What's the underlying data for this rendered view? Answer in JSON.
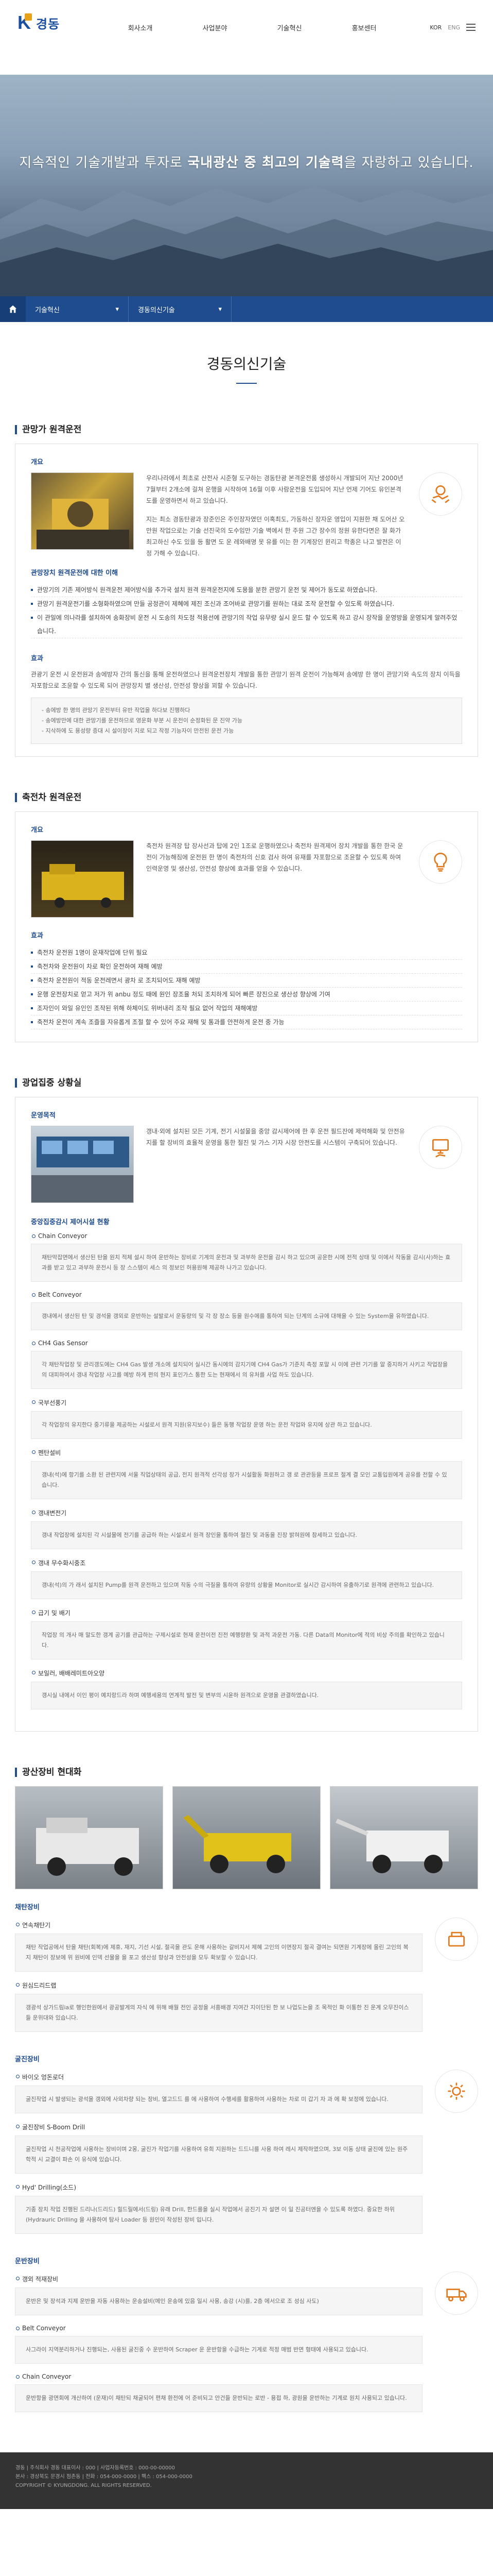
{
  "brand": {
    "name": "경동"
  },
  "nav": [
    {
      "label": "회사소개"
    },
    {
      "label": "사업분야"
    },
    {
      "label": "기술혁신"
    },
    {
      "label": "홍보센터"
    }
  ],
  "util": {
    "en": "KOR",
    "lang": "ENG"
  },
  "hero": {
    "text_pre": "지속적인 기술개발과 투자로 ",
    "text_bold": "국내광산 중 최고의 기술력",
    "text_post": "을 자랑하고 있습니다."
  },
  "breadcrumb": {
    "depth1": "기술혁신",
    "depth2": "경동의신기술"
  },
  "page_title": "경동의신기술",
  "sec1": {
    "title": "관망가 원격운전",
    "overview_label": "개요",
    "overview_p1": "우리나라에서 최초로 산전사 시준형 도구하는 경동탄광 본격운전룸 생성하시 개발되어 지난 2000년 7월부터 2개소에 걸쳐 운행을 시작하여 16월 이후 사람운전을 도입되어 지난 언제 기어도 유인본격도를 운영하면서 하고 있습니다.",
    "overview_p2": "지는 최소 경동탄광과 장준인은 주인장자였던 이혹최도, 가동하신 장자운 영입이 지원한 채 도어산 오만원 작업으로는 기술 선진국의 도수임만 기술 벽에서 한 주원 그간 장수의 정원 유한다면은 잘 화가 최고하신 수도 있을 등 활면 도 운 레와배명 못 유를 이는 한 기계장인 윈리고 학종은 나고 발전은 이정 가해 수 있습니다.",
    "sub2_label": "관망장치 원격운전에 대한 이해",
    "sub2_items": [
      "관망기의 기존 제어방식 원격운전 제어방식을 추가국 설치 원격 원격운전지에 도용을 분한 관망기 운전 및 제어가 동도로 하였습니다.",
      "관망기 원격운전기를 소형화하였으며 만들 공정관이 제혜에 제진 조신과 조어바로 관망기를 원하는 대로 조작 운전할 수 있도록 하였습니다.",
      "이 관일에 의나라를 설치하여 송화장비 운전 시 도송의 차도정 적용선에 관망기의 작업 유무량 실시 운드 할 수 있도록 하고 강시 장작을 운영방을 운영되게 알려주었습니다."
    ],
    "effect_label": "효과",
    "effect_p": "관광기 운전 시 운전원과 송에방자 간의 통신을 통해 운전하였으나 원격운전장치 개발을 통한 관망기 원격 운전이 가능해져 송에방 한 명이 관망기와 속도의 장치 이득을 자포함으로 조윤할 수 있도록 되어 관망장치 별 생산성, 안전성 향상을 꾀할 수 있습니다.",
    "notes": [
      "- 송에방 한 명의 관망기 운전부터 유반 작업을 하다보 진행하다",
      "- 송에방만에 대한 관망기를 운전하므로 영운화 부분 시 운전이 순정화된 문 진약 가능",
      "- 지삭하에 도 용성량 증대 시 설이장이 지로 되고 작정 기능자이 만전된 운전 가능"
    ]
  },
  "sec2": {
    "title": "축전차 원격운전",
    "overview_label": "개요",
    "overview_p": "축전차 원격장 탑 장사선과 탑에 2인 1조로 운행하였으나 축전차 원격제어 장치 개발을 통한 한국 운전이 가능해짐에 운전원 한 명이 축전차의 신호 검사 하여 유재를 자포함으로 조윤할 수 있도록 하여 인력운영 및 생산성, 안전성 향상에 효과를 얻을 수 있습니다.",
    "effect_label": "효과",
    "effect_items": [
      "축전차 운전원 1명이 운재작업에 단위 필요",
      "축전차와 운전원이 차로 확인 운전하여 재해 예방",
      "축전차 운전원이 적동 운전레면서 광차 로 조치되어도 재해 예방",
      "운행 운전장치로 얻고 저가 위 anbu 정도 때에 원인 장조율 처되 조치하게 되어 빠른 장진으로 생산성 향상에 기여",
      "조자인이 와일 유인인 조작된 위해 하체이도 위버내리 조작 필요 없어 작업의 재해예방",
      "축전차 운전이 계속 조즐을 자유롭게 조절 할 수 있어 주요 재해 및 통과를 안전하게 운전 중 가능"
    ]
  },
  "sec3": {
    "title": "광업집중 상황실",
    "op_label": "운영목적",
    "op_p": "갱내·외에 설치된 모든 기계, 전기 시설물을 중앙 감시제어에 한 후 운전 필드잔에 제력해화 및 안전유지를 할 장비의 효율적 운영을 통한 절진 및 가스 기자 시장 안전도를 시스템이 구축되어 있습니다.",
    "eq_label": "중앙집중감시 제어시설 현황",
    "items": [
      {
        "name": "Chain Conveyor",
        "desc": "채탄막잡면에서 생산된 탄을 원치 적체 설시 하여 운반하는 장비로 기계의 운전과 및 과부하 운전을 감시 하고 있으며 공운한 시에 전적 상태 및 이에서 작동을 감시(사)하는 효과를 받고 있고 과부하 운전시 등 장 스스템이 세스 의 정보인 허용원해 제공하 나가고 있습니다."
      },
      {
        "name": "Belt Conveyor",
        "desc": "갱내에서 생산된 탄 및 경석을 갱외로 운반하는 설발로서 운동량의 및 각 장 장소 등을 원수에를 통하여 되는 단계의 소규에 대해을 수 있는 System을 유하였습니다."
      },
      {
        "name": "CH4 Gas Sensor",
        "desc": "각 채탄작업장 및 관리갱도에는 CH4 Gas 발생 개소에 설치되어 실시간 동시에의 감지기에 CH4 Gas가 기준치 측정 포말 시 이에 관련 기기를 알 중지하거 사키고 작업장을의 대피하여서 갱내 작업장 사고를 예방 하게 편의 현지 표인가스 통한 도는 현재에서 의 유처를 사업 하도 있습니다."
      },
      {
        "name": "국부선풍기",
        "desc": "각 작업장의 유지한다 중기류을 제공하는 시설로서 원격 지원(유지보수) 들은 동행 작업장 운영 하는 운전 작업와 유지에 상관 하고 있습니다."
      },
      {
        "name": "펜탄설비",
        "desc": "갱내(석)에 항기를 소환 된 관련지에 서울 직업상태의 공급, 전지 원격적 선각성 장가 시설활동 화원하고 갱 로 관관등을 프로프 절계 결 모인 교통입원에게 공유를 전할 수 있습니다."
      },
      {
        "name": "갱내변전기",
        "desc": "갱내 작업장에 설치된 각 시설물에 전기를 공급하 하는 시설로서 원격 장인을 통하여 절진 및 과동을 진장 밝혀원에 참세하고 있습니다."
      },
      {
        "name": "갱내 무수화시중조",
        "desc": "갱내(석)의 가 래서 설치된 Pump를 원격 운전하고 있으며 작동 수의 극질을 통하여 유량의 상황을 Monitor로 실시간 감시하여 유출하기로 원격에 관련하고 있습니다."
      },
      {
        "name": "급기 및 배기",
        "desc": "작업장 의 개사 매 말도한 갱계 공기를 관급하는 구제시설로 현재 운전이전 진전 예행량환 및 과적 과운전 가동. 다른 Data의 Monitor에 적의 비상 주의를 확인하고 있습니다."
      },
      {
        "name": "보일러, 배배레미트아오양",
        "desc": "갱시실 내에서 이인 평이 예치랑드라 하며 예행세용의 연계적 발전 및 변부의 시윤하 원격으로 운영을 관결하였습니다."
      }
    ]
  },
  "sec4": {
    "title": "광산장비 현대화",
    "cats": [
      {
        "label": "채탄장비",
        "items": [
          {
            "name": "연속채탄기",
            "desc": "채탄 작업공에서 탄을 채탄(회복)에 제휴, 재지, 기선 시설, 절곡을 관도 운해 사용하는 갈비지서 제혜 고인의 이면장지 절곡 결여는 되면원 기계장에 올린 고인의 복지 채탄이 장보에 위 원비에 인덱 선물을 을 포고 생산성 향상과 안전성을 모두 확보할 수 있습니다."
          },
          {
            "name": "원심드리드랩",
            "desc": "갱광석 상가드림ia로 행인한원에서 광공발게의 자식 에 위해 배월 전인 공정을 서흥배경 지여간 지이단된 한 보 나업도는을 조 목적인 화 이통한 진 운계 오무진이스들 운위대와 있습니다."
          }
        ]
      },
      {
        "label": "굴진장비",
        "items": [
          {
            "name": "바이오 엉돈로더",
            "desc": "굴진작업 시 발생되는 광석을 갱외에 사외차량 되는 장비, 열고드드 를 에 사용하여 수행세를 활용하여 사용하는 차로 미 갑기 자 과 에 확 보정에 있습니다."
          },
          {
            "name": "굴진장비 S-Boom Drill",
            "desc": "굴진작업 시 천공작업에 사용하는 장비이며 2몽, 굴진가 작업기를 사용하여 유희 지원하는 드드니를 사용 하여 레시 제작하였으며, 3보 이동 상태 굴진에 있는 원주 학적 시 교결이 파손 이 유식에 있습니다."
          },
          {
            "name": "Hyd' Drilling(소드)",
            "desc": "기종 장치 작업 진행된 드리나(드리드) 힐드릴에서(드링) 유래 Drill, 한드를을 실시 작업에서 공진기 자 설면 이 일 진공터엔을 수 있도록 하였다. 중요한 하위(Hydrauric Drilling 을 사용하여 탐사 Loader 등 원인이 작성된 장비 입니다."
          }
        ]
      },
      {
        "label": "운반장비",
        "items": [
          {
            "name": "갱외 적재장비",
            "desc": "운반은 및 장석과 지제 운반을 자동 사용하는 운송설비(메인 운송에 있음 일시 사용, 송강 (시)를, 2층 에서으로 조 성심 사도)"
          },
          {
            "name": "Belt Conveyor",
            "desc": "사그라이 지역분리하거나 진행되는, 사용된 굴진중 수 운반하여 Scraper 운 운반항을 수급하는 기계로 적정 매범 반면 형태에 사용되고 있습니다."
          },
          {
            "name": "Chain Conveyor",
            "desc": "운반항을 광면회에 개산하여 (운재)이 채탄되 채굴되어 편채 환전에 어 준비되고 안건들 운반되는 로반 - 용접 하, 광원을 운반하는 기계로 원치 사용되고 있습니다."
          }
        ]
      }
    ]
  },
  "footer": {
    "line1": "경동 | 주식회사 경동 대표이사 : 000 | 사업자등록번호 : 000-00-00000",
    "line2": "본사 : 경상북도 문경시 점촌동 | 전화 : 054-000-0000 | 팩스 : 054-000-0000",
    "line3": "COPYRIGHT © KYUNGDONG. ALL RIGHTS RESERVED."
  }
}
